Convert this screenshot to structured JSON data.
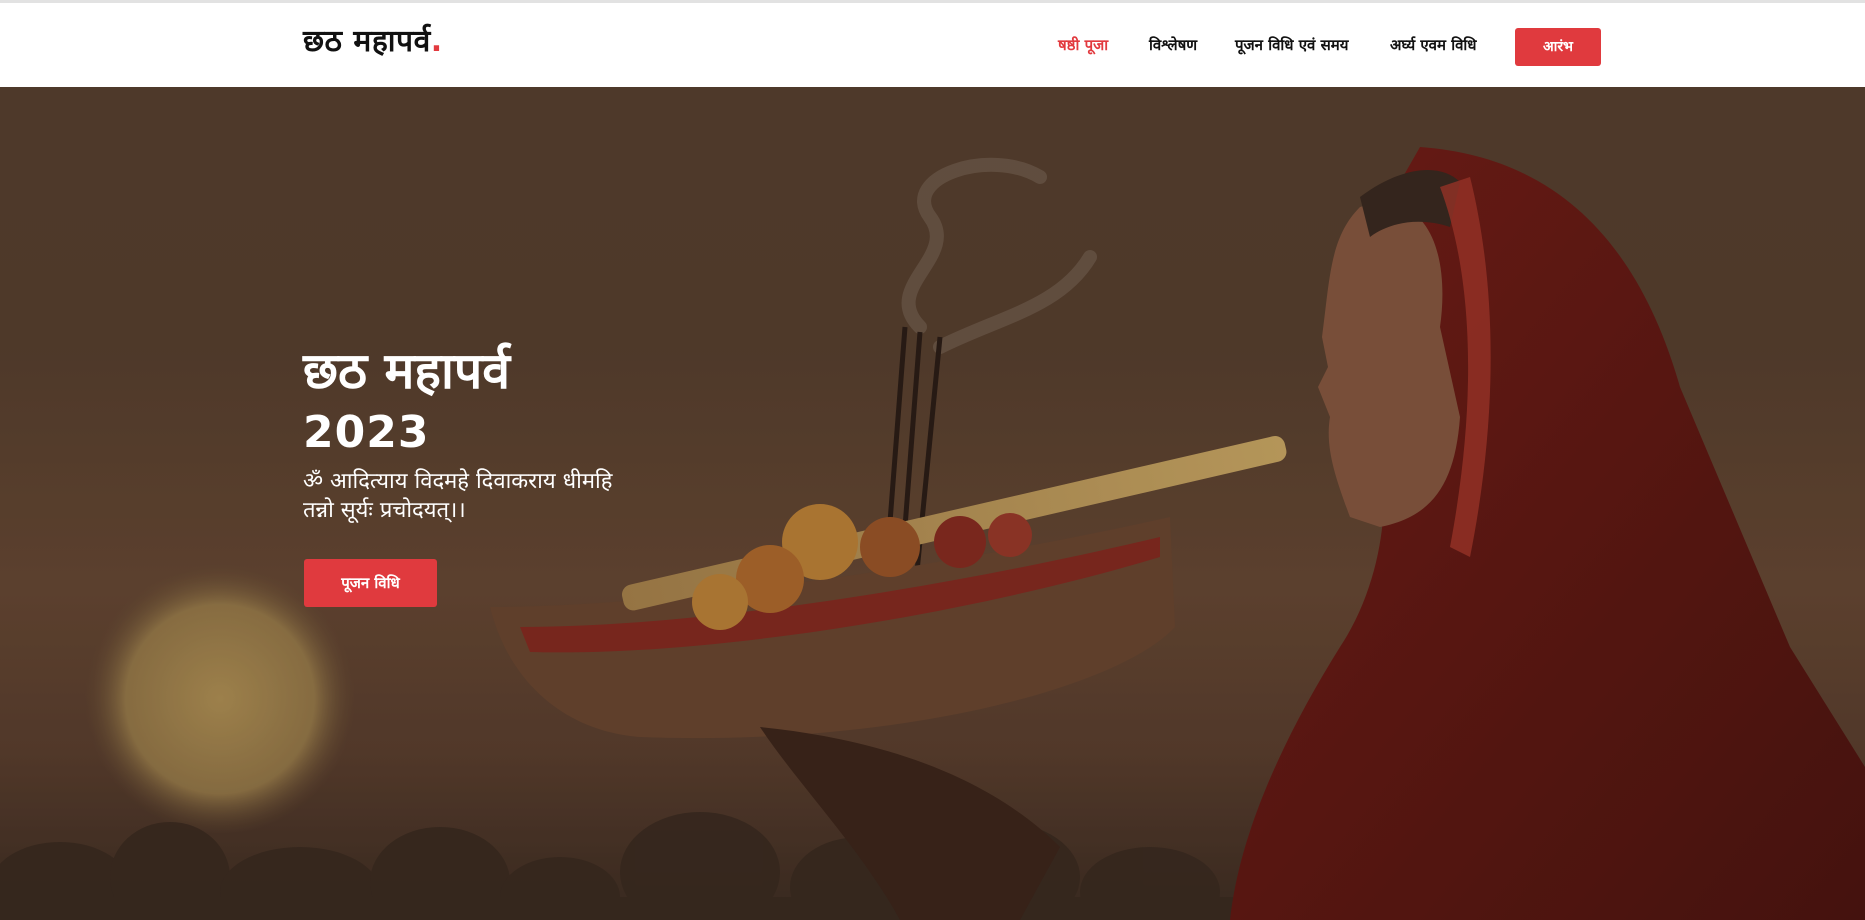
{
  "header": {
    "logo_text": "छठ महापर्व",
    "logo_dot": ".",
    "nav": [
      {
        "label": "षष्ठी पूजा",
        "active": true
      },
      {
        "label": "विश्लेषण",
        "active": false
      },
      {
        "label": "पूजन विधि एवं समय",
        "active": false
      },
      {
        "label": "अर्घ्य एवम विधि",
        "active": false
      }
    ],
    "cta_label": "आरंभ"
  },
  "hero": {
    "title": "छठ महापर्व",
    "year": "2023",
    "mantra_line1": "ॐ आदित्याय विदमहे दिवाकराय धीमहि",
    "mantra_line2": "तन्नो सूर्यः प्रचोदयत्।।",
    "button_label": "पूजन विधि",
    "image_icon": "woman-offering-soop-icon"
  },
  "colors": {
    "accent": "#e23a3f",
    "header_bg": "#ffffff",
    "hero_overlay": "#5a4331"
  }
}
